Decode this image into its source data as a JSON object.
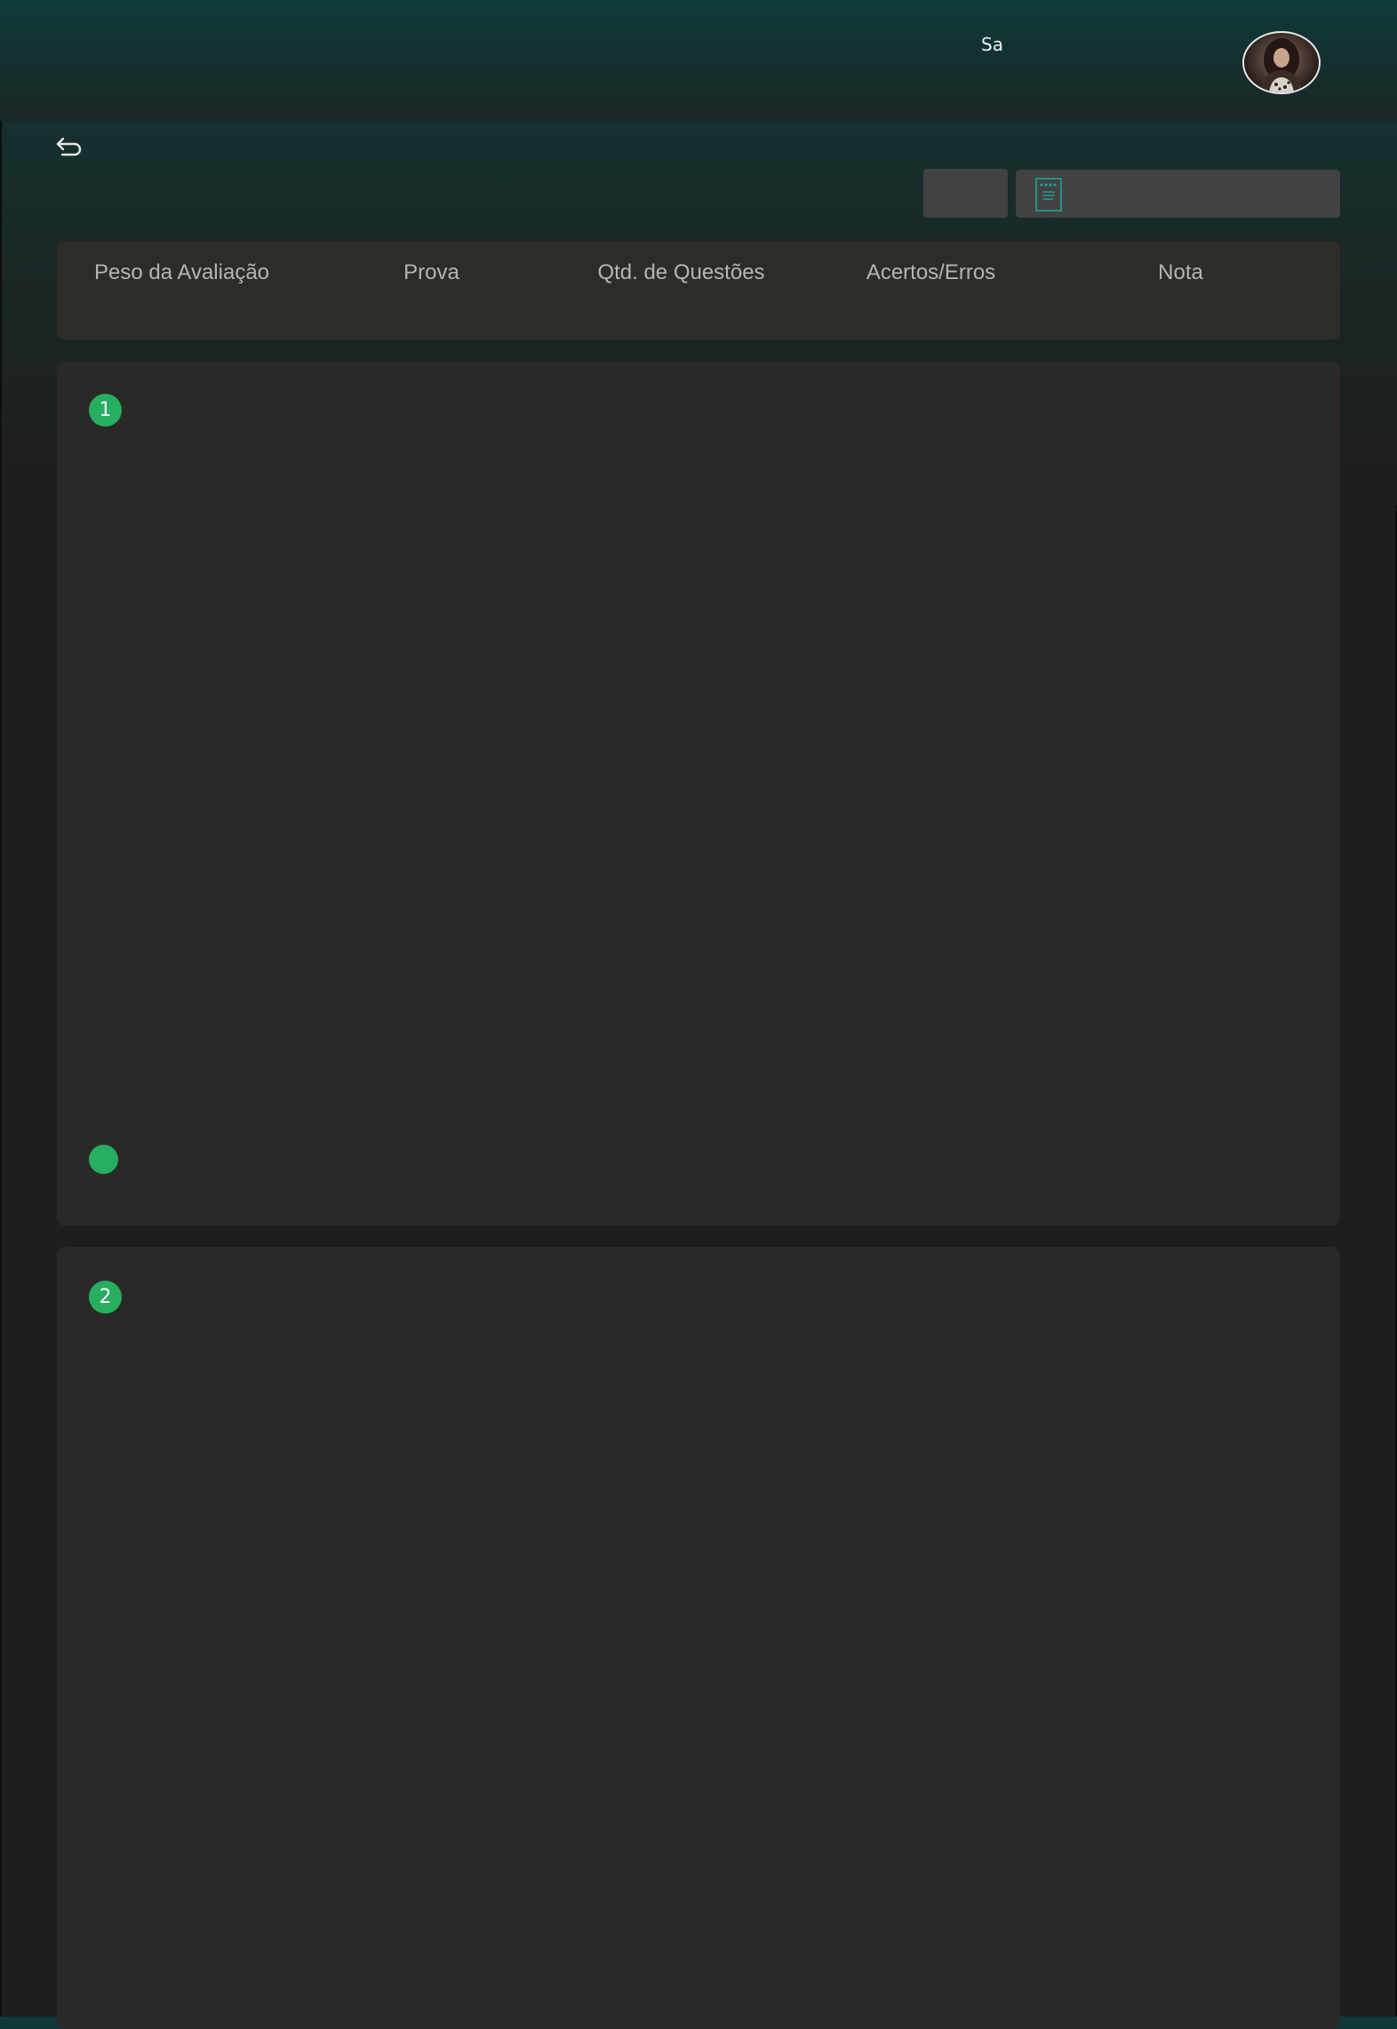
{
  "header": {
    "user_name": "Sa"
  },
  "table_header": {
    "columns": [
      "Peso da Avaliação",
      "Prova",
      "Qtd. de Questões",
      "Acertos/Erros",
      "Nota"
    ]
  },
  "questions": [
    {
      "number": "1"
    },
    {
      "number": "2"
    }
  ],
  "icons": {
    "back": "return-arrow-icon",
    "document": "document-icon",
    "avatar": "user-avatar"
  },
  "colors": {
    "accent_green": "#27ae60",
    "doc_icon": "#1fa39a",
    "card_bg": "#2a2927",
    "header_teal": "#10373a"
  }
}
